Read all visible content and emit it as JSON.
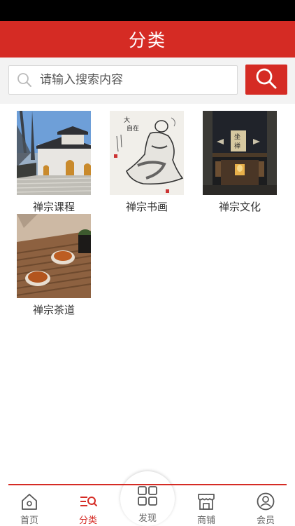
{
  "header": {
    "title": "分类"
  },
  "search": {
    "placeholder": "请输入搜索内容",
    "value": ""
  },
  "categories": [
    {
      "label": "禅宗课程",
      "image": "temple-gate"
    },
    {
      "label": "禅宗书画",
      "image": "monk-painting"
    },
    {
      "label": "禅宗文化",
      "image": "meditation-hall"
    },
    {
      "label": "禅宗茶道",
      "image": "tea-cups"
    }
  ],
  "tabbar": {
    "items": [
      {
        "label": "首页",
        "icon": "home-icon"
      },
      {
        "label": "分类",
        "icon": "category-icon",
        "active": true
      },
      {
        "label": "发现",
        "icon": "grid-icon"
      },
      {
        "label": "商铺",
        "icon": "store-icon"
      },
      {
        "label": "会员",
        "icon": "user-icon"
      }
    ]
  },
  "colors": {
    "brand": "#d52b24",
    "statusbar": "#000000",
    "search_bg": "#f3f3f3"
  }
}
